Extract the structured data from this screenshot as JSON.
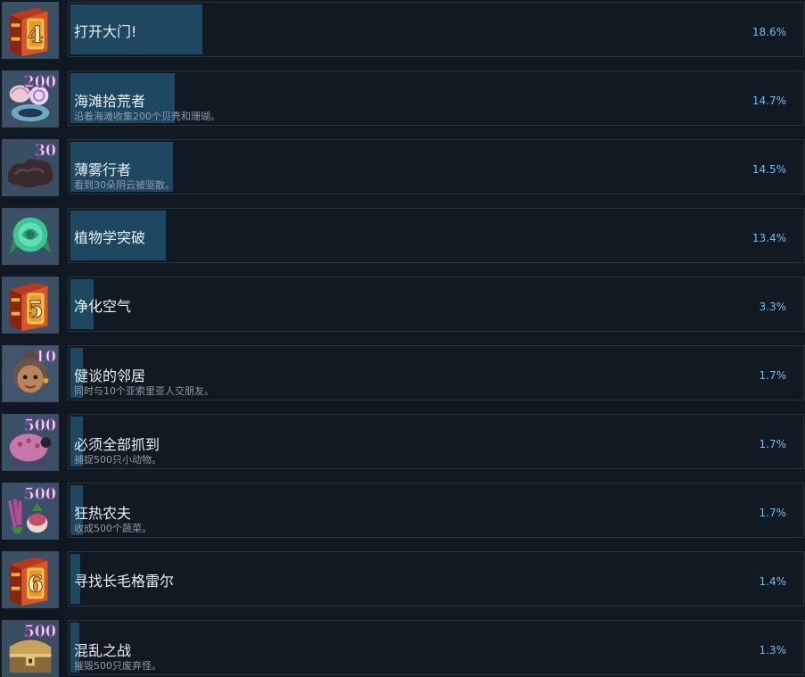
{
  "accent": "#66c0f4",
  "achievements": [
    {
      "icon": "book-4-icon",
      "badge": "4",
      "title": "打开大门!",
      "desc": "",
      "percent_label": "18.6%",
      "percent": 18.6
    },
    {
      "icon": "seashells-icon",
      "badge": "200",
      "title": "海滩拾荒者",
      "desc": "沿着海滩收集200个贝壳和珊瑚。",
      "percent_label": "14.7%",
      "percent": 14.7
    },
    {
      "icon": "dark-cloud-icon",
      "badge": "30",
      "title": "薄雾行者",
      "desc": "看到30朵阴云被驱散。",
      "percent_label": "14.5%",
      "percent": 14.5
    },
    {
      "icon": "rose-icon",
      "badge": "",
      "title": "植物学突破",
      "desc": "",
      "percent_label": "13.4%",
      "percent": 13.4
    },
    {
      "icon": "book-5-icon",
      "badge": "5",
      "title": "净化空气",
      "desc": "",
      "percent_label": "3.3%",
      "percent": 3.3
    },
    {
      "icon": "villager-portrait-icon",
      "badge": "10",
      "title": "健谈的邻居",
      "desc": "同时与10个亚索里亚人交朋友。",
      "percent_label": "1.7%",
      "percent": 1.7
    },
    {
      "icon": "pink-critter-icon",
      "badge": "500",
      "title": "必须全部抓到",
      "desc": "捕捉500只小动物。",
      "percent_label": "1.7%",
      "percent": 1.7
    },
    {
      "icon": "vegetables-icon",
      "badge": "500",
      "title": "狂热农夫",
      "desc": "收成500个蔬菜。",
      "percent_label": "1.7%",
      "percent": 1.7
    },
    {
      "icon": "book-6-icon",
      "badge": "6",
      "title": "寻找长毛格雷尔",
      "desc": "",
      "percent_label": "1.4%",
      "percent": 1.4
    },
    {
      "icon": "treasure-chest-icon",
      "badge": "500",
      "title": "混乱之战",
      "desc": "摧毁500只废弃怪。",
      "percent_label": "1.3%",
      "percent": 1.3
    }
  ]
}
